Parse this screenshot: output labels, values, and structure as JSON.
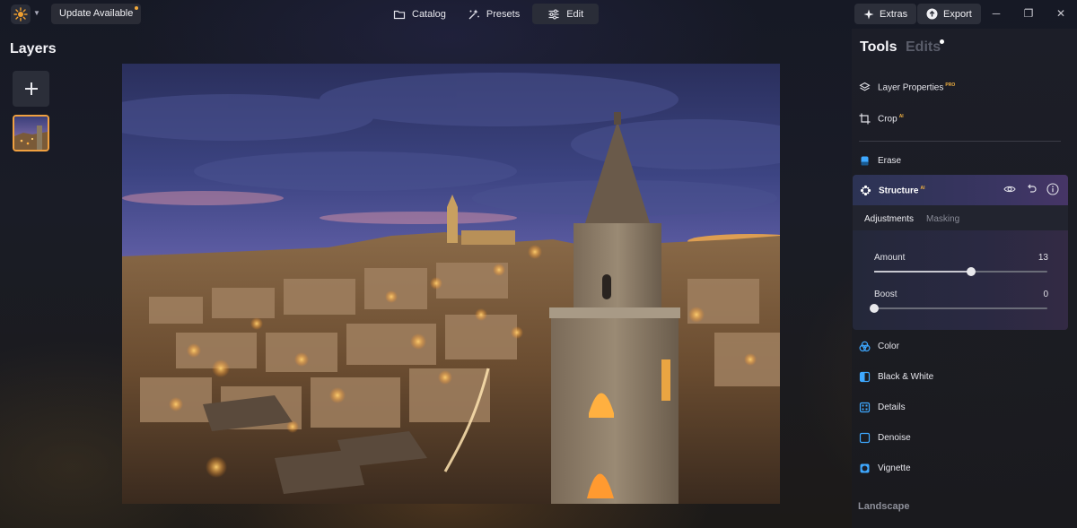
{
  "topbar": {
    "update_label": "Update Available",
    "nav": [
      {
        "label": "Catalog",
        "icon": "folder-icon"
      },
      {
        "label": "Presets",
        "icon": "sparkle-icon"
      },
      {
        "label": "Edit",
        "icon": "sliders-icon"
      }
    ],
    "active_nav": "Edit",
    "extras_label": "Extras",
    "export_label": "Export",
    "window_controls": [
      "minimize",
      "restore",
      "close"
    ]
  },
  "layers": {
    "title": "Layers",
    "add_icon": "plus-icon"
  },
  "panel": {
    "tabs": {
      "tools": "Tools",
      "edits": "Edits"
    },
    "tools_top": [
      {
        "label": "Layer Properties",
        "tag": "PRO",
        "icon": "layers-icon"
      },
      {
        "label": "Crop",
        "tag": "AI",
        "icon": "crop-icon"
      }
    ],
    "erase": {
      "label": "Erase",
      "icon": "eraser-icon"
    },
    "structure": {
      "label": "Structure",
      "tag": "AI",
      "subtabs": [
        "Adjustments",
        "Masking"
      ],
      "active_subtab": "Adjustments",
      "sliders": [
        {
          "label": "Amount",
          "value": "13",
          "fraction": 0.56
        },
        {
          "label": "Boost",
          "value": "0",
          "fraction": 0.0
        }
      ]
    },
    "tools_bottom": [
      {
        "label": "Color",
        "icon": "color-icon"
      },
      {
        "label": "Black & White",
        "icon": "bw-icon"
      },
      {
        "label": "Details",
        "icon": "details-icon"
      },
      {
        "label": "Denoise",
        "icon": "denoise-icon"
      },
      {
        "label": "Vignette",
        "icon": "vignette-icon"
      }
    ],
    "section": "Landscape"
  },
  "colors": {
    "accent": "#f0a040",
    "icon_blue": "#3ea8ff",
    "panel_bg": "#1c1e28"
  }
}
